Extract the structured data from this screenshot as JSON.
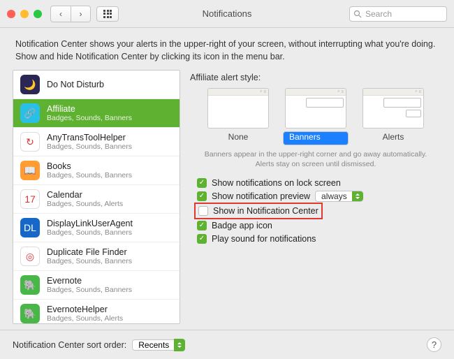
{
  "title": "Notifications",
  "search_placeholder": "Search",
  "description": "Notification Center shows your alerts in the upper-right of your screen, without interrupting what you're doing. Show and hide Notification Center by clicking its icon in the menu bar.",
  "sidebar": {
    "items": [
      {
        "name": "Do Not Disturb",
        "sub": "",
        "icon_bg": "#2a2656",
        "icon": "🌙"
      },
      {
        "name": "Affiliate",
        "sub": "Badges, Sounds, Banners",
        "icon_bg": "#29c0e7",
        "icon": "🔗",
        "selected": true
      },
      {
        "name": "AnyTransToolHelper",
        "sub": "Badges, Sounds, Banners",
        "icon_bg": "#ffffff",
        "icon": "↻"
      },
      {
        "name": "Books",
        "sub": "Badges, Sounds, Banners",
        "icon_bg": "#ff9d33",
        "icon": "📖"
      },
      {
        "name": "Calendar",
        "sub": "Badges, Sounds, Alerts",
        "icon_bg": "#ffffff",
        "icon": "17"
      },
      {
        "name": "DisplayLinkUserAgent",
        "sub": "Badges, Sounds, Banners",
        "icon_bg": "#1667c7",
        "icon": "DL"
      },
      {
        "name": "Duplicate File Finder",
        "sub": "Badges, Sounds, Banners",
        "icon_bg": "#ffffff",
        "icon": "◎"
      },
      {
        "name": "Evernote",
        "sub": "Badges, Sounds, Banners",
        "icon_bg": "#49b648",
        "icon": "🐘"
      },
      {
        "name": "EvernoteHelper",
        "sub": "Badges, Sounds, Alerts",
        "icon_bg": "#49b648",
        "icon": "🐘"
      }
    ]
  },
  "right": {
    "heading": "Affiliate alert style:",
    "styles": [
      {
        "label": "None"
      },
      {
        "label": "Banners",
        "selected": true
      },
      {
        "label": "Alerts"
      }
    ],
    "hint": "Banners appear in the upper-right corner and go away automatically. Alerts stay on screen until dismissed.",
    "options": {
      "lock_screen": {
        "label": "Show notifications on lock screen",
        "checked": true
      },
      "preview": {
        "label": "Show notification preview",
        "checked": true,
        "select": "always"
      },
      "center": {
        "label": "Show in Notification Center",
        "checked": false
      },
      "badge": {
        "label": "Badge app icon",
        "checked": true
      },
      "sound": {
        "label": "Play sound for notifications",
        "checked": true
      }
    }
  },
  "footer": {
    "label": "Notification Center sort order:",
    "value": "Recents"
  },
  "help": "?"
}
